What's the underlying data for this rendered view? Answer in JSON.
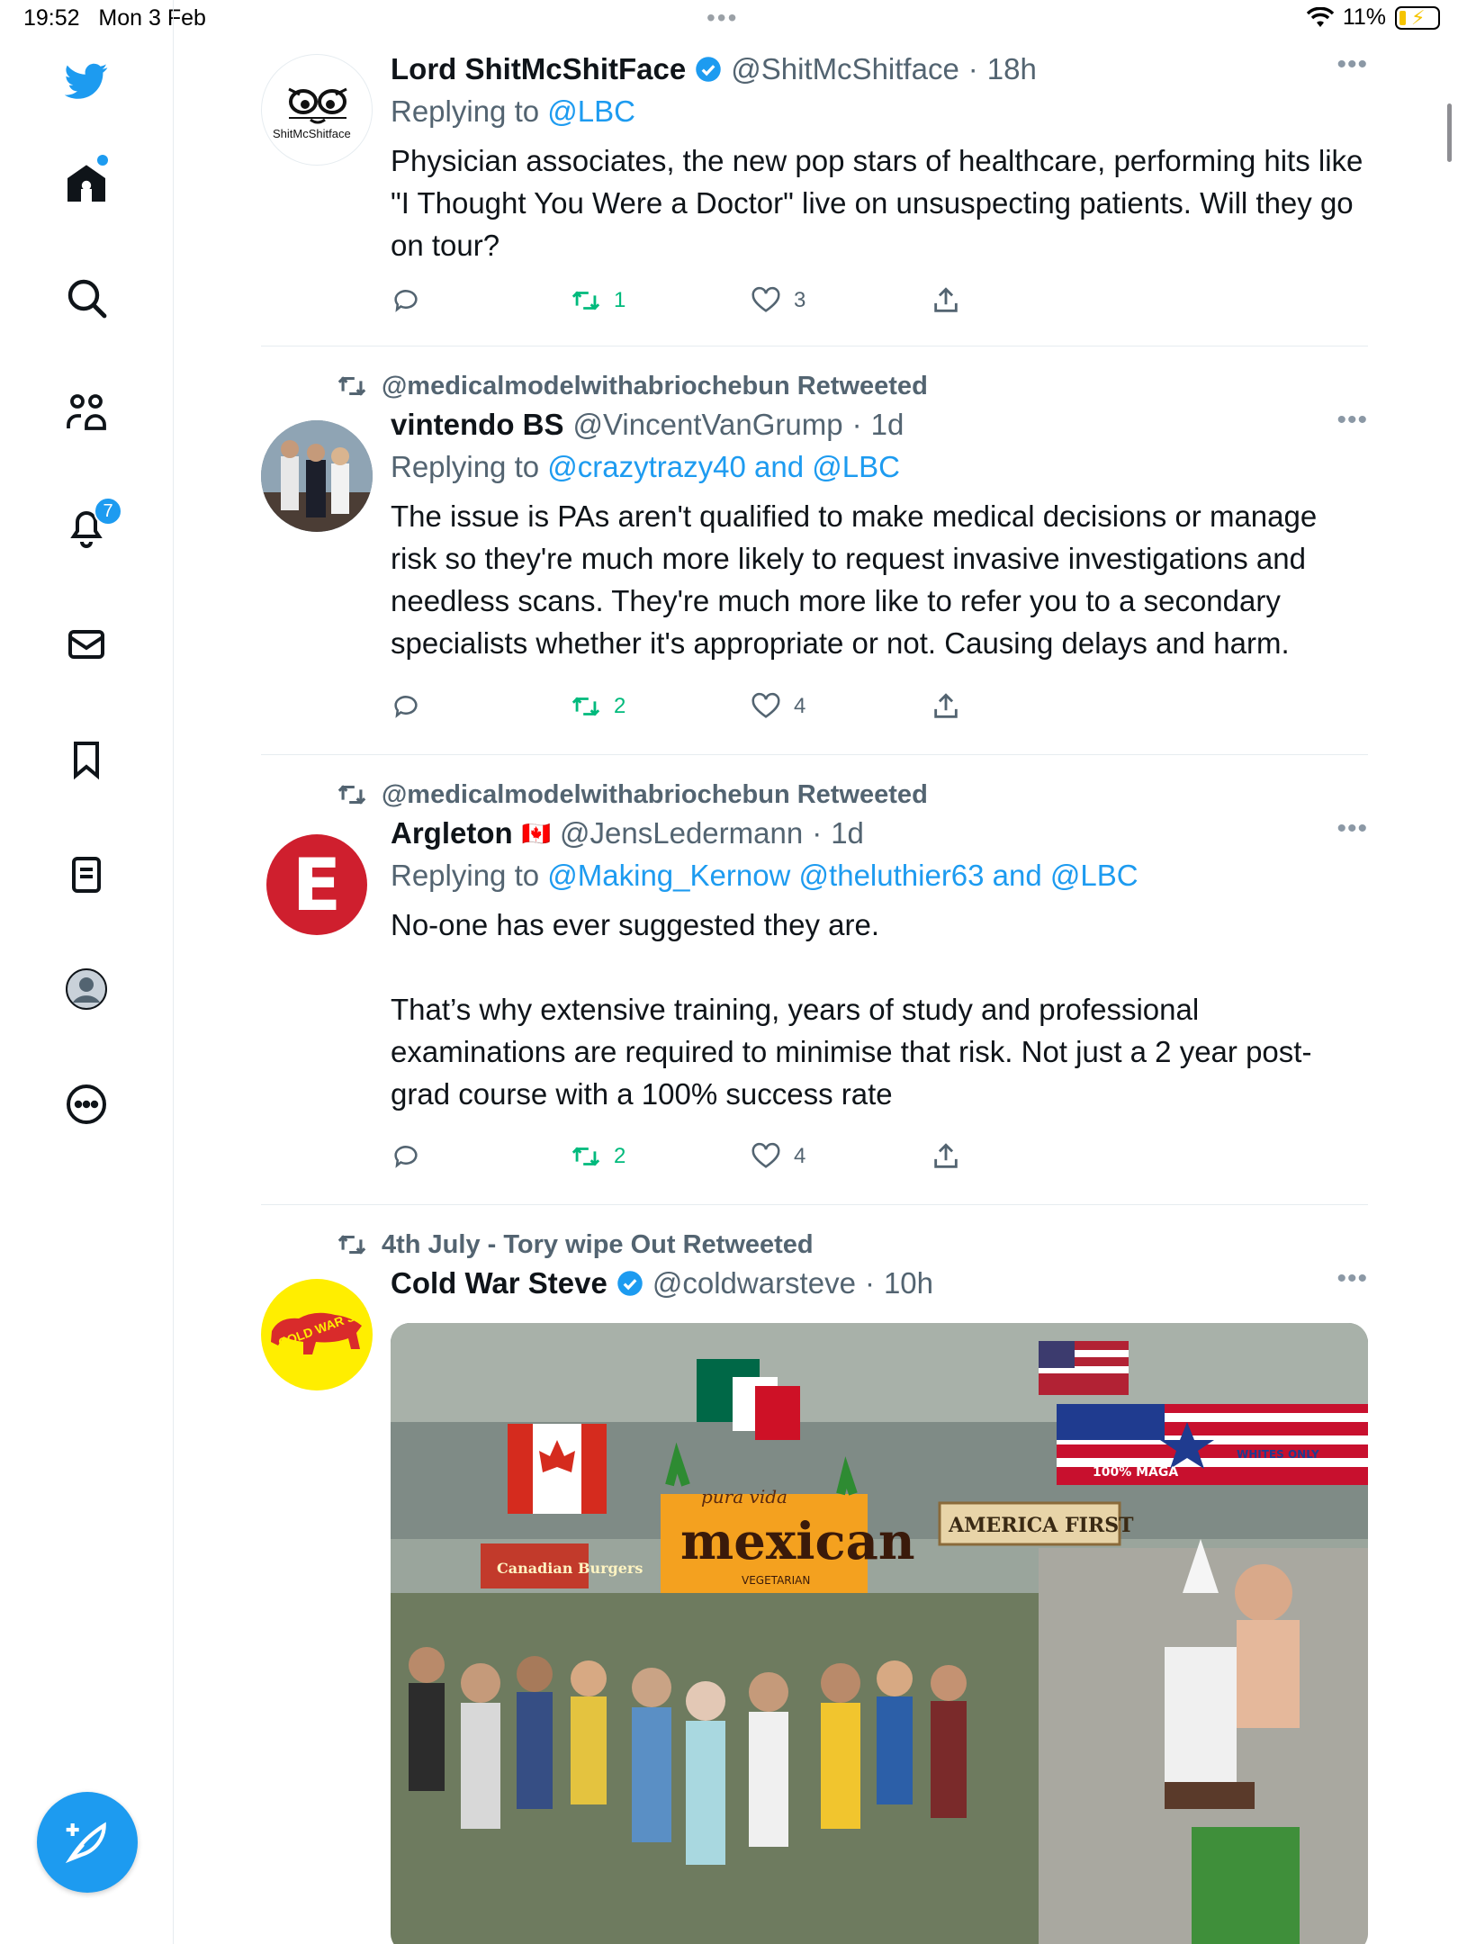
{
  "status_bar": {
    "time": "19:52",
    "date": "Mon 3 Feb",
    "battery": "11%"
  },
  "sidebar": {
    "items": [
      "home-icon",
      "search-icon",
      "communities-icon",
      "notifications-icon",
      "messages-icon",
      "bookmarks-icon",
      "lists-icon",
      "profile-icon",
      "more-icon"
    ],
    "notifications_badge": "7"
  },
  "tweets": [
    {
      "retweeted_by": "",
      "name": "Lord ShitMcShitFace",
      "verified": true,
      "handle": "@ShitMcShitface",
      "time": "18h",
      "replying_prefix": "Replying to ",
      "replying_to": "@LBC",
      "text": [
        "Physician associates, the new pop stars of healthcare, performing hits like \"I Thought You Were a Doctor\" live on unsuspecting patients. Will they go on tour?"
      ],
      "retweets": "1",
      "likes": "3",
      "avatar_label": "ShitMcShitface"
    },
    {
      "retweeted_by": "@medicalmodelwithabriochebun Retweeted",
      "name": "vintendo BS",
      "verified": false,
      "handle": "@VincentVanGrump",
      "time": "1d",
      "replying_prefix": "Replying to ",
      "replying_to": "@crazytrazy40 and @LBC",
      "text": [
        "The issue is PAs aren't qualified to make medical decisions or manage risk so they're much more likely to request invasive investigations and needless scans. They're much more like to refer you to a secondary specialists whether it's appropriate or not. Causing delays and harm."
      ],
      "retweets": "2",
      "likes": "4"
    },
    {
      "retweeted_by": "@medicalmodelwithabriochebun Retweeted",
      "name": "Argleton",
      "flag": "🇨🇦",
      "verified": false,
      "handle": "@JensLedermann",
      "time": "1d",
      "replying_prefix": "Replying to ",
      "replying_to": "@Making_Kernow @theluthier63 and @LBC",
      "text": [
        "No-one has ever suggested they are.",
        "",
        "That’s why extensive training, years of study and professional examinations are required to minimise that risk. Not just a 2 year post-grad course with a 100% success rate"
      ],
      "retweets": "2",
      "likes": "4",
      "avatar_letter": "E"
    },
    {
      "retweeted_by": "4th July - Tory wipe Out Retweeted",
      "name": "Cold War Steve",
      "verified": true,
      "handle": "@coldwarsteve",
      "time": "10h",
      "avatar_label": "COLD WAR STEVE",
      "image_signs": {
        "mexican_top": "pura vida",
        "mexican": "mexican",
        "mexican_sub": "VEGETARIAN",
        "america_first": "AMERICA FIRST",
        "maga": "100% MAGA",
        "whites_only": "WHITES ONLY",
        "burgers": "Canadian Burgers"
      }
    }
  ],
  "colors": {
    "accent": "#1d9bf0",
    "retweet": "#00ba7c",
    "muted": "#536471"
  }
}
